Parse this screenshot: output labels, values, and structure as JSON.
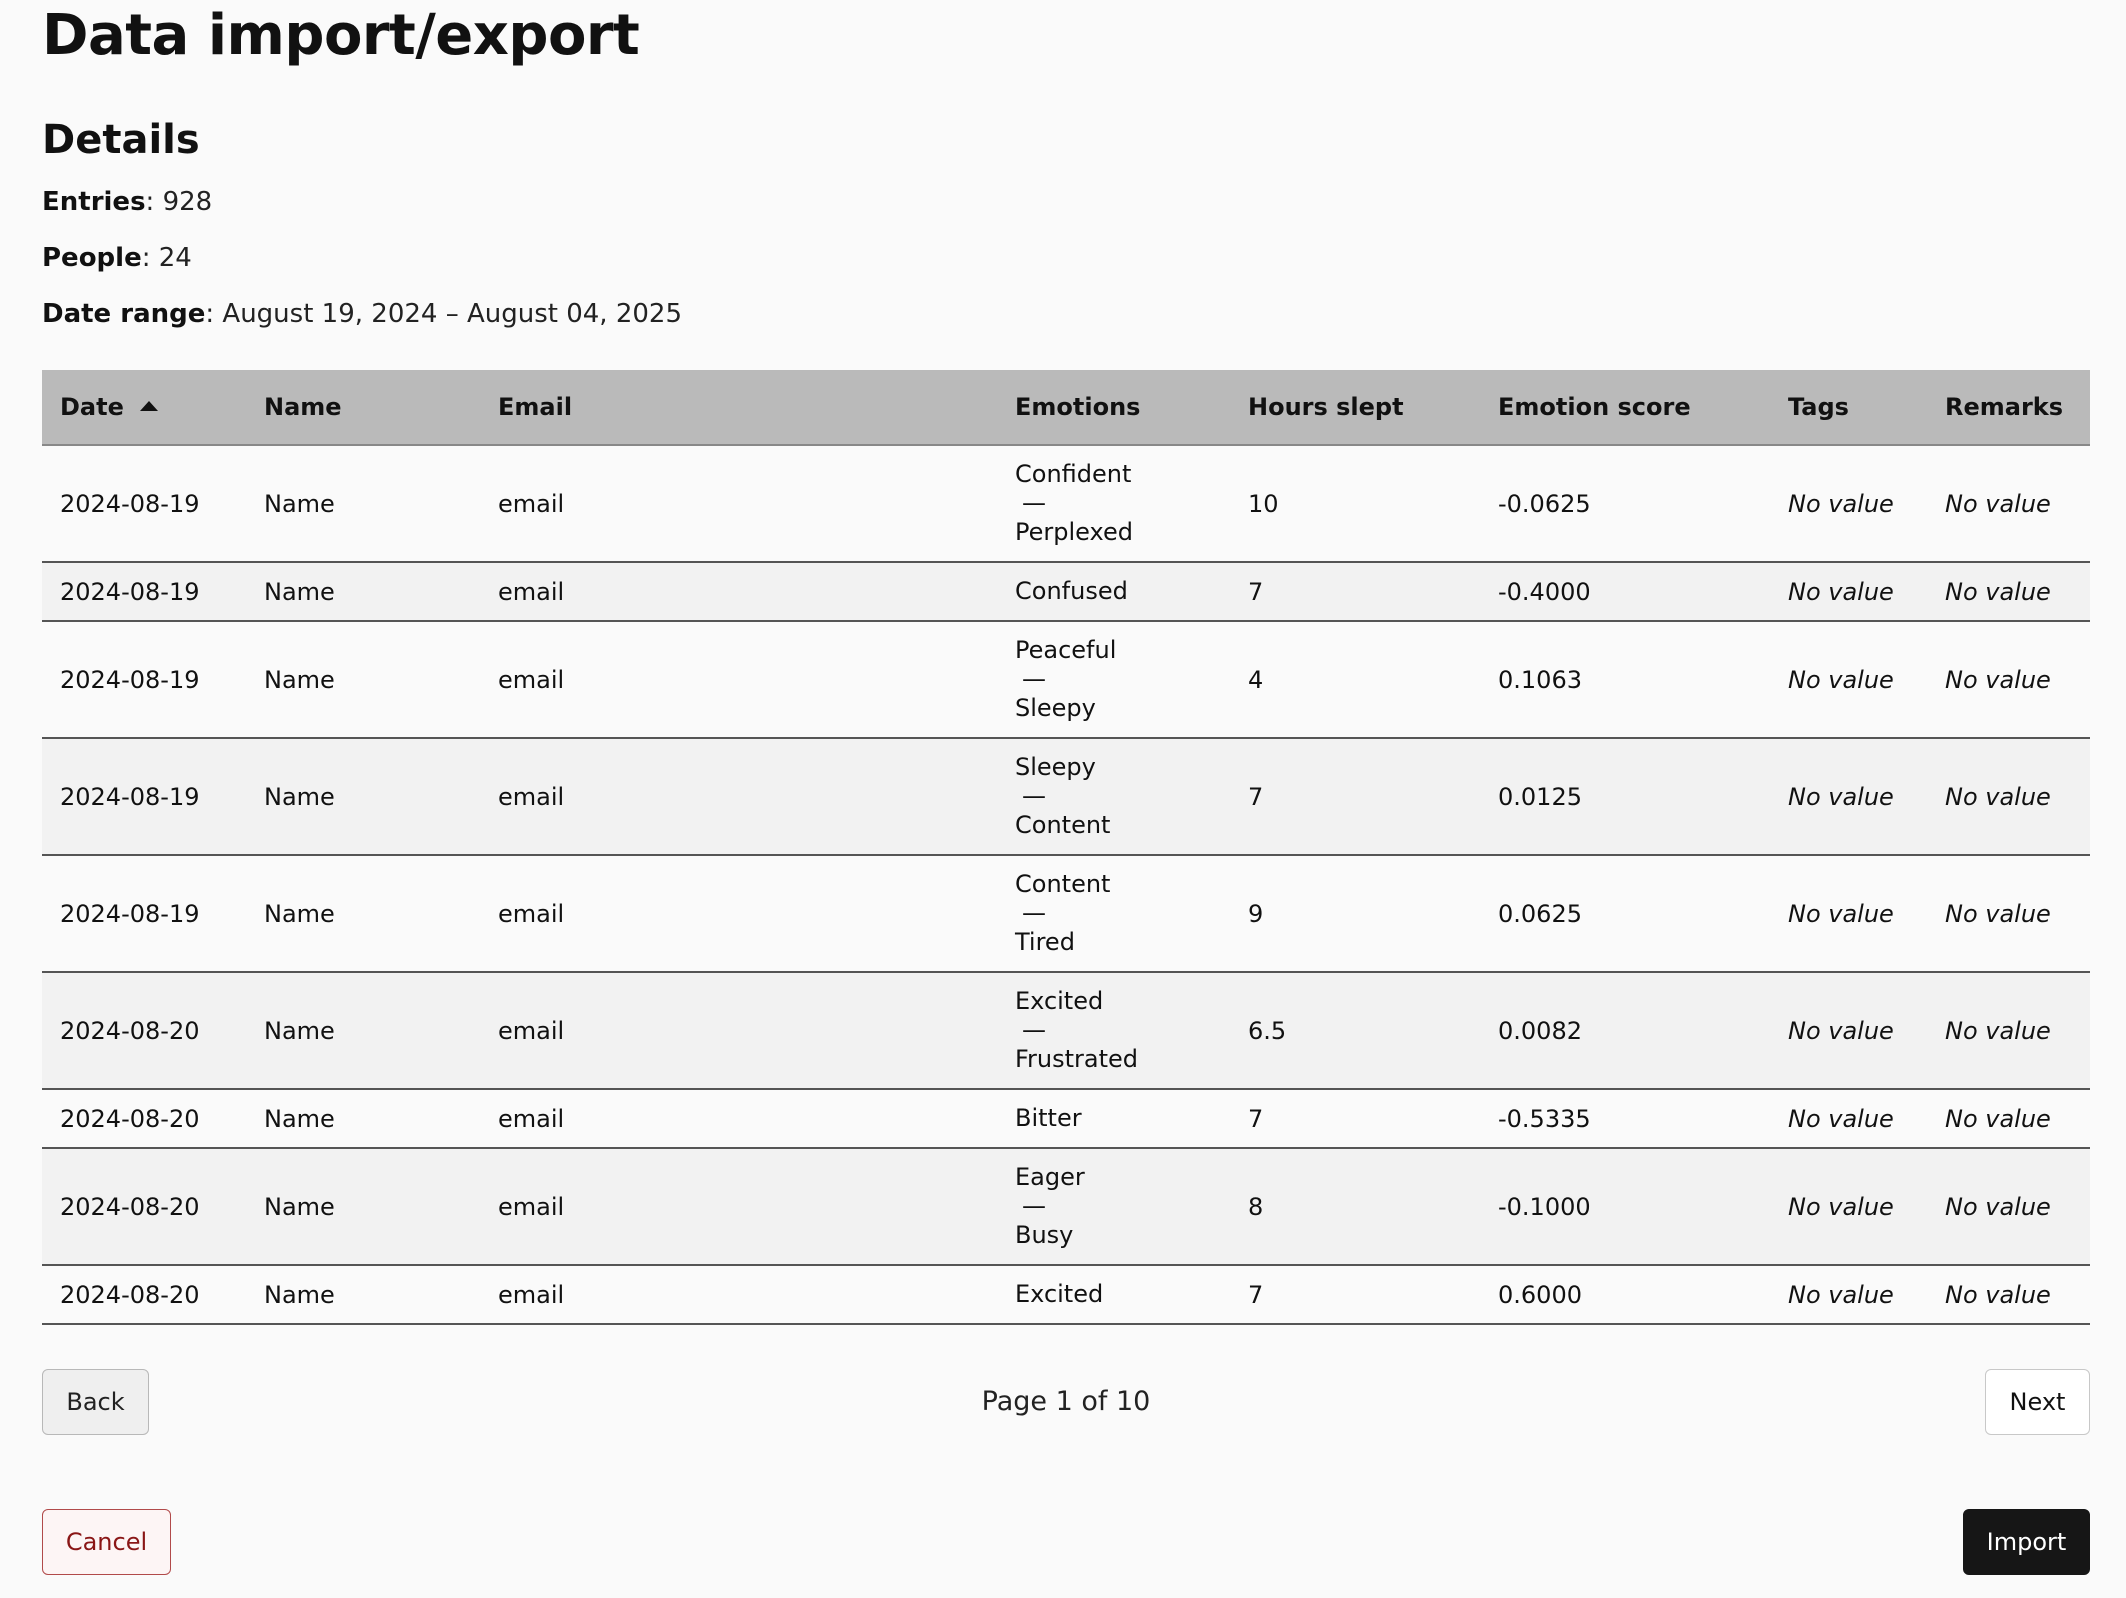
{
  "page": {
    "title": "Data import/export"
  },
  "details": {
    "heading": "Details",
    "entries_label": "Entries",
    "entries_value": "928",
    "people_label": "People",
    "people_value": "24",
    "date_range_label": "Date range",
    "date_range_value": "August 19, 2024 – August 04, 2025"
  },
  "table": {
    "columns": [
      "Date",
      "Name",
      "Email",
      "Emotions",
      "Hours slept",
      "Emotion score",
      "Tags",
      "Remarks"
    ],
    "sort": {
      "column": "Date",
      "direction": "ascending"
    },
    "separator": "—",
    "rows": [
      {
        "date": "2024-08-19",
        "name": "Name",
        "email": "email",
        "emotions": [
          "Confident",
          "Perplexed"
        ],
        "hours": "10",
        "score": "-0.0625",
        "tags": "No value",
        "remarks": "No value"
      },
      {
        "date": "2024-08-19",
        "name": "Name",
        "email": "email",
        "emotions": [
          "Confused"
        ],
        "hours": "7",
        "score": "-0.4000",
        "tags": "No value",
        "remarks": "No value"
      },
      {
        "date": "2024-08-19",
        "name": "Name",
        "email": "email",
        "emotions": [
          "Peaceful",
          "Sleepy"
        ],
        "hours": "4",
        "score": "0.1063",
        "tags": "No value",
        "remarks": "No value"
      },
      {
        "date": "2024-08-19",
        "name": "Name",
        "email": "email",
        "emotions": [
          "Sleepy",
          "Content"
        ],
        "hours": "7",
        "score": "0.0125",
        "tags": "No value",
        "remarks": "No value"
      },
      {
        "date": "2024-08-19",
        "name": "Name",
        "email": "email",
        "emotions": [
          "Content",
          "Tired"
        ],
        "hours": "9",
        "score": "0.0625",
        "tags": "No value",
        "remarks": "No value"
      },
      {
        "date": "2024-08-20",
        "name": "Name",
        "email": "email",
        "emotions": [
          "Excited",
          "Frustrated"
        ],
        "hours": "6.5",
        "score": "0.0082",
        "tags": "No value",
        "remarks": "No value"
      },
      {
        "date": "2024-08-20",
        "name": "Name",
        "email": "email",
        "emotions": [
          "Bitter"
        ],
        "hours": "7",
        "score": "-0.5335",
        "tags": "No value",
        "remarks": "No value"
      },
      {
        "date": "2024-08-20",
        "name": "Name",
        "email": "email",
        "emotions": [
          "Eager",
          "Busy"
        ],
        "hours": "8",
        "score": "-0.1000",
        "tags": "No value",
        "remarks": "No value"
      },
      {
        "date": "2024-08-20",
        "name": "Name",
        "email": "email",
        "emotions": [
          "Excited"
        ],
        "hours": "7",
        "score": "0.6000",
        "tags": "No value",
        "remarks": "No value"
      }
    ]
  },
  "pagination": {
    "back_label": "Back",
    "next_label": "Next",
    "page_text": "Page 1 of 10"
  },
  "actions": {
    "cancel_label": "Cancel",
    "import_label": "Import"
  },
  "colors": {
    "header_bg": "#bababa",
    "cancel_border": "#b14a4a",
    "cancel_text": "#8a1616",
    "import_bg": "#161616"
  }
}
